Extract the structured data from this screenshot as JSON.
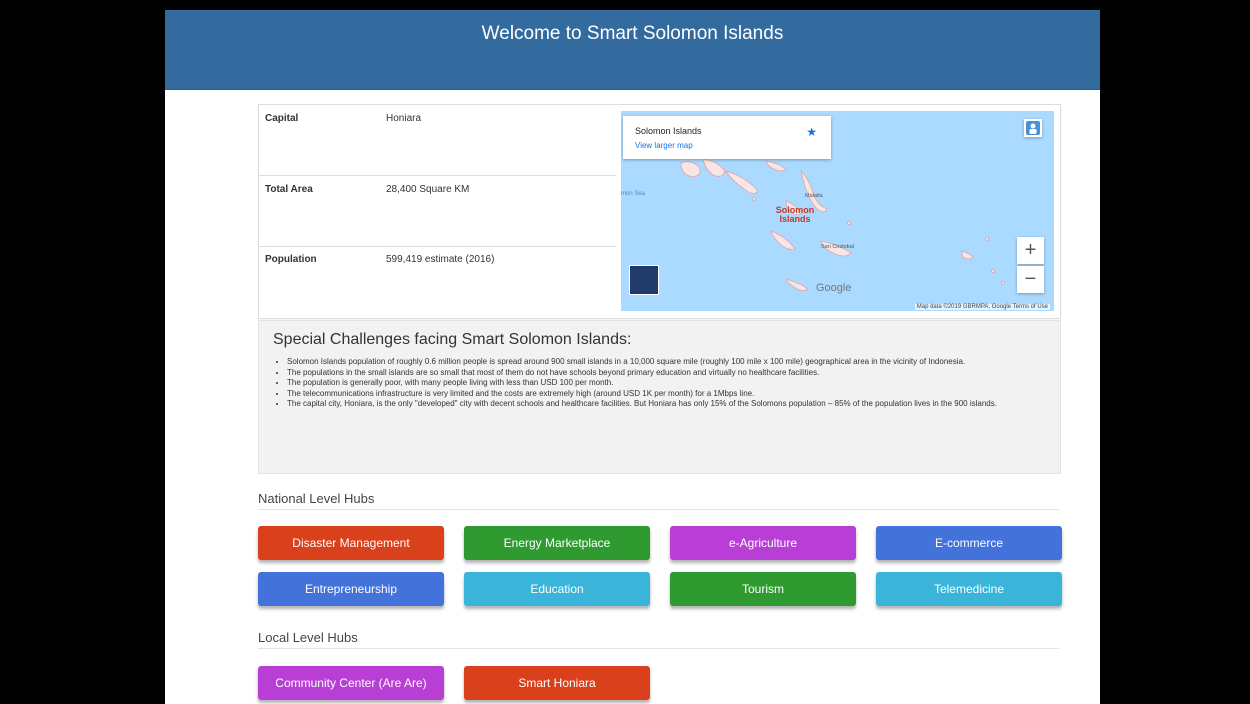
{
  "header": {
    "title": "Welcome to Smart Solomon Islands"
  },
  "facts": [
    {
      "key": "Capital",
      "value": "Honiara"
    },
    {
      "key": "Total Area",
      "value": "28,400 Square KM"
    },
    {
      "key": "Population",
      "value": "599,419 estimate (2016)"
    }
  ],
  "map": {
    "card_title": "Solomon Islands",
    "card_link": "View larger map",
    "star_icon": "star-icon",
    "zoom_in": "+",
    "zoom_out": "−",
    "label_main": "Solomon Islands",
    "label_malaita": "Malaita",
    "label_san_cristobal": "San Cristobal",
    "label_sea": "mon Sea",
    "google": "Google",
    "footer": "Map data ©2019 GBRMPA, Google   Terms of Use",
    "colors": {
      "water": "#aadaff",
      "land": "#f6e6e6"
    }
  },
  "challenges": {
    "title": "Special Challenges facing Smart Solomon Islands:",
    "items": [
      "Solomon Islands population of roughly 0.6 million people is spread around 900 small islands in a 10,000 square mile (roughly 100 mile x 100 mile) geographical area in the vicinity of Indonesia.",
      "The populations in the small islands are so small that most of them do not have schools beyond primary education and virtually no healthcare facilities.",
      "The population is generally poor, with many people living with less than USD 100 per month.",
      "The telecommunications infrastructure is very limited and the costs are extremely high (around USD 1K per month) for a 1Mbps line.",
      "The capital city, Honiara, is the only \"developed\" city with decent schools and healthcare facilities. But Honiara has only 15% of the Solomons population – 85% of the population lives in the 900 islands."
    ]
  },
  "national_hubs": {
    "title": "National Level Hubs",
    "buttons": [
      {
        "label": "Disaster Management",
        "color": "#d9401c"
      },
      {
        "label": "Energy Marketplace",
        "color": "#2f9a2f"
      },
      {
        "label": "e-Agriculture",
        "color": "#b83ed6"
      },
      {
        "label": "E-commerce",
        "color": "#4472db"
      },
      {
        "label": "Entrepreneurship",
        "color": "#4472db"
      },
      {
        "label": "Education",
        "color": "#3ab4d8"
      },
      {
        "label": "Tourism",
        "color": "#2f9a2f"
      },
      {
        "label": "Telemedicine",
        "color": "#3ab4d8"
      }
    ]
  },
  "local_hubs": {
    "title": "Local Level Hubs",
    "buttons": [
      {
        "label": "Community Center (Are Are)",
        "color": "#b83ed6"
      },
      {
        "label": "Smart Honiara",
        "color": "#d9401c"
      }
    ]
  }
}
